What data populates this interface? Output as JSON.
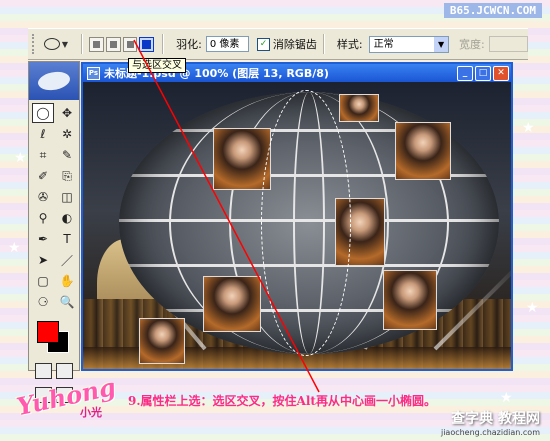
{
  "brand": "B65.JCWCN.COM",
  "options_bar": {
    "feather_label": "羽化:",
    "feather_value": "0 像素",
    "antialias_checked": "✓",
    "antialias_label": "消除锯齿",
    "style_label": "样式:",
    "style_value": "正常",
    "width_label": "宽度:"
  },
  "tooltip": "与选区交叉",
  "document": {
    "title": "未标题-1.psd @ 100% (图层 13, RGB/8)",
    "minimize": "_",
    "restore": "□",
    "close": "✕"
  },
  "toolbox": {
    "tools": [
      "◯",
      "✥",
      "ℓ",
      "✲",
      "⌗",
      "✎",
      "✐",
      "⎘",
      "✇",
      "◫",
      "⚲",
      "◐",
      "✒",
      "T",
      "➤",
      "／",
      "▢",
      "✋",
      "⚆",
      "🔍"
    ]
  },
  "colors": {
    "foreground": "#ff0000",
    "background": "#000000",
    "accent": "#ff2a86"
  },
  "caption": "9.属性栏上选：选区交叉，按住Alt再从中心画一小椭圆。",
  "logo": {
    "text": "Yuhong",
    "sub": "小光"
  },
  "watermark": {
    "main": "查字典 教程网",
    "sub": "jiaocheng.chazidian.com"
  }
}
